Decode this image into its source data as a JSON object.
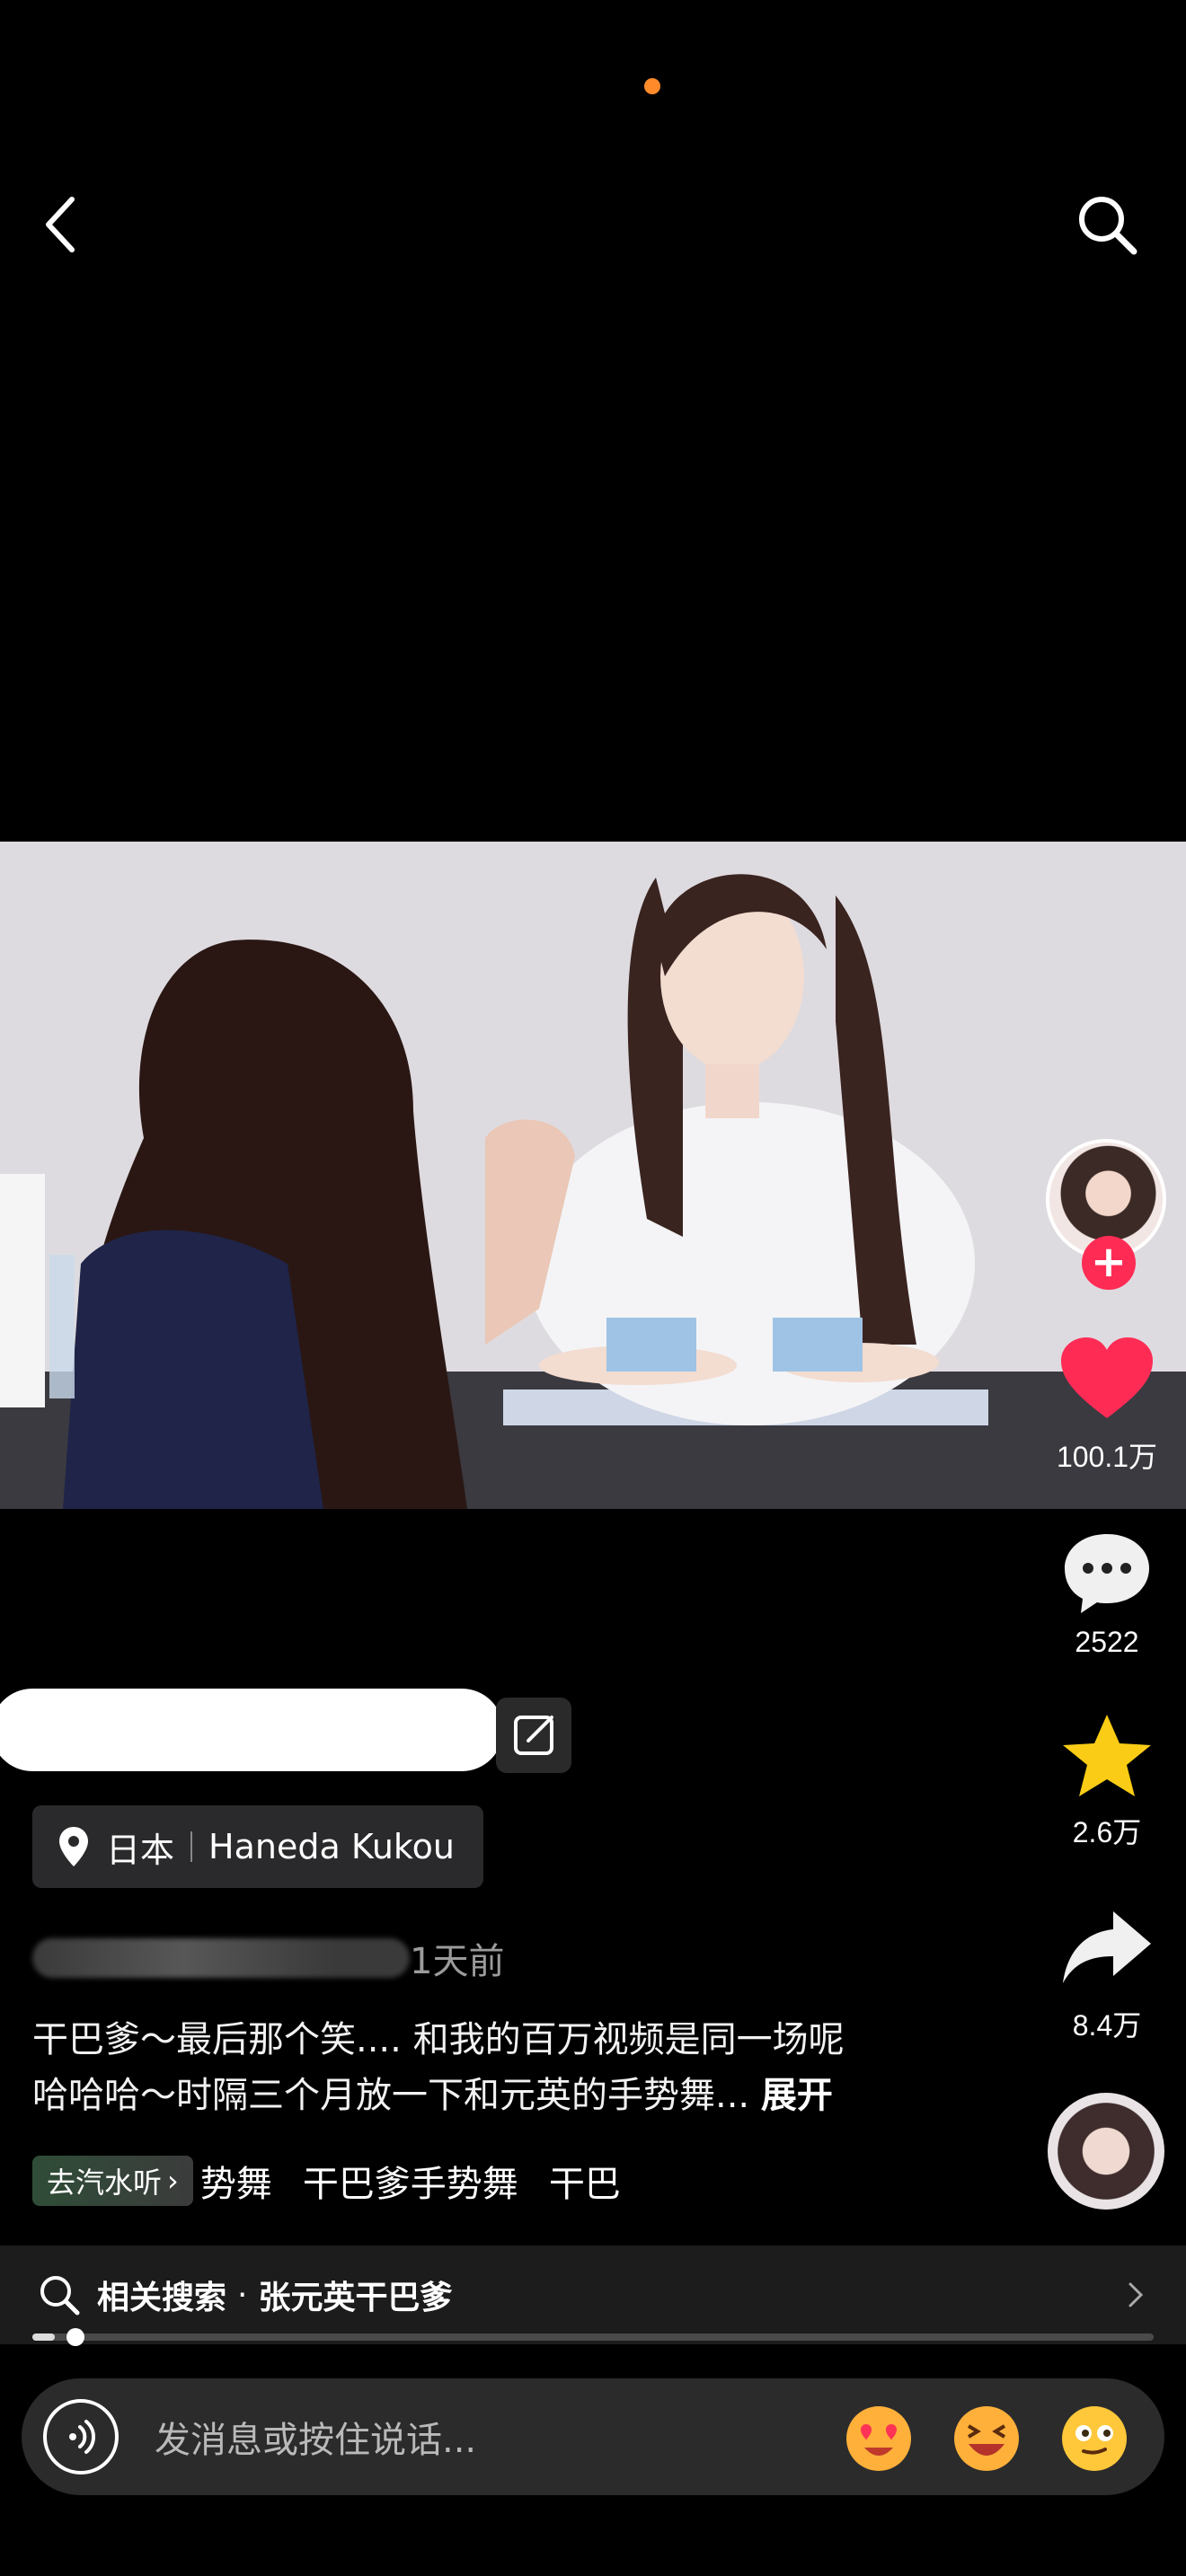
{
  "top_bar": {
    "back_icon": "chevron-left-icon",
    "search_icon": "search-icon"
  },
  "video": {
    "description": "photo of two women at a table; one smiling in white t-shirt with long dark hair"
  },
  "rail": {
    "like_count": "100.1万",
    "comment_count": "2522",
    "favorite_count": "2.6万",
    "share_count": "8.4万",
    "like_color": "#fe2c55",
    "favorite_color": "#facc15"
  },
  "caption": {
    "location_country": "日本",
    "location_place": "Haneda Kukou",
    "time_ago": "1天前",
    "description_line1": "干巴爹～最后那个笑.... 和我的百万视频是同一场呢",
    "description_line2": "哈哈哈～时隔三个月放一下和元英的手势舞... ",
    "expand_label": "展开",
    "music_tag_label": "去汽水听",
    "tags": [
      "势舞",
      "干巴爹手势舞",
      "干巴"
    ]
  },
  "related_search": {
    "prefix": "相关搜索",
    "dot": "·",
    "query": "张元英干巴爹"
  },
  "progress": {
    "fraction": 0.02
  },
  "message_bar": {
    "placeholder": "发消息或按住说话...",
    "emojis": [
      "heart-eyes-emoji",
      "laughing-emoji",
      "dizzy-emoji"
    ]
  }
}
